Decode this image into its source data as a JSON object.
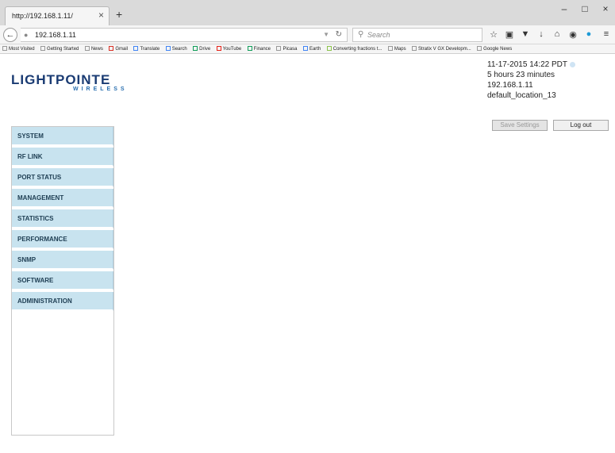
{
  "browser": {
    "tab_title": "http://192.168.1.11/",
    "tab_close": "×",
    "new_tab": "+",
    "url": "192.168.1.11",
    "search_placeholder": "Search",
    "window_controls": {
      "minimize": "–",
      "maximize": "□",
      "close": "×"
    },
    "bookmarks": [
      "Most Visited",
      "Getting Started",
      "News",
      "Gmail",
      "Translate",
      "Search",
      "Drive",
      "YouTube",
      "Finance",
      "Picasa",
      "Earth",
      "Converting fractions t...",
      "Maps",
      "Stratix V GX Developm...",
      "Google News"
    ]
  },
  "logo": {
    "main": "LIGHTPOINTE",
    "sub": "WIRELESS"
  },
  "info": {
    "datetime": "11-17-2015 14:22 PDT",
    "uptime": "5 hours 23 minutes",
    "ip": "192.168.1.11",
    "location": "default_location_13"
  },
  "buttons": {
    "save": "Save Settings",
    "logout": "Log out"
  },
  "menu": [
    "SYSTEM",
    "RF LINK",
    "PORT STATUS",
    "MANAGEMENT",
    "STATISTICS",
    "PERFORMANCE",
    "SNMP",
    "SOFTWARE",
    "ADMINISTRATION"
  ],
  "colors": {
    "menu_bg": "#c8e3ef",
    "logo": "#1a3b73"
  }
}
